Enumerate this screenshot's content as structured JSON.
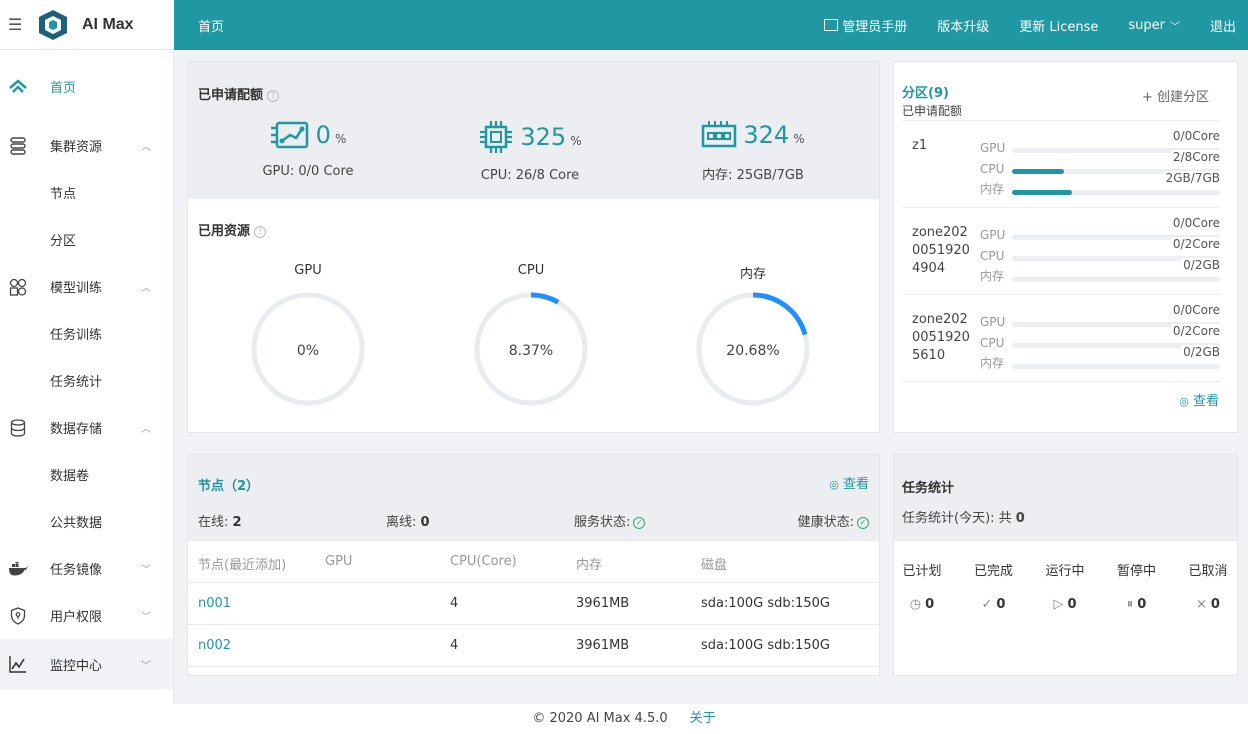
{
  "brand": {
    "name": "AI Max"
  },
  "topbar": {
    "home": "首页",
    "manual": "管理员手册",
    "upgrade": "版本升级",
    "license": "更新 License",
    "user": "super",
    "logout": "退出"
  },
  "sidebar": {
    "items": [
      {
        "label": "首页",
        "icon": "home-icon"
      },
      {
        "label": "集群资源",
        "icon": "server-icon"
      },
      {
        "label": "节点"
      },
      {
        "label": "分区"
      },
      {
        "label": "模型训练",
        "icon": "grid-icon"
      },
      {
        "label": "任务训练"
      },
      {
        "label": "任务统计"
      },
      {
        "label": "数据存储",
        "icon": "database-icon"
      },
      {
        "label": "数据卷"
      },
      {
        "label": "公共数据"
      },
      {
        "label": "任务镜像",
        "icon": "docker-icon"
      },
      {
        "label": "用户权限",
        "icon": "shield-icon"
      },
      {
        "label": "监控中心",
        "icon": "chart-line-icon"
      }
    ]
  },
  "quota": {
    "title": "已申请配额",
    "items": [
      {
        "value": "0",
        "unit": "%",
        "sub": "GPU: 0/0 Core",
        "icon": "gpu-icon"
      },
      {
        "value": "325",
        "unit": "%",
        "sub": "CPU: 26/8 Core",
        "icon": "cpu-icon"
      },
      {
        "value": "324",
        "unit": "%",
        "sub": "内存: 25GB/7GB",
        "icon": "memory-icon"
      }
    ]
  },
  "used": {
    "title": "已用资源",
    "items": [
      {
        "label": "GPU",
        "value": "0%",
        "fraction": 0
      },
      {
        "label": "CPU",
        "value": "8.37%",
        "fraction": 0.0837
      },
      {
        "label": "内存",
        "value": "20.68%",
        "fraction": 0.2068
      }
    ]
  },
  "partitions": {
    "title": "分区(9)",
    "subtitle": "已申请配额",
    "create": "+ 创建分区",
    "view": "查看",
    "groups": [
      {
        "name": "z1",
        "rows": [
          {
            "k": "GPU",
            "v": "0/0Core",
            "f": 0
          },
          {
            "k": "CPU",
            "v": "2/8Core",
            "f": 0.25
          },
          {
            "k": "内存",
            "v": "2GB/7GB",
            "f": 0.29
          }
        ]
      },
      {
        "name": "zone2020051920 4904",
        "rows": [
          {
            "k": "GPU",
            "v": "0/0Core",
            "f": 0
          },
          {
            "k": "CPU",
            "v": "0/2Core",
            "f": 0
          },
          {
            "k": "内存",
            "v": "0/2GB",
            "f": 0
          }
        ]
      },
      {
        "name": "zone2020051920 5610",
        "rows": [
          {
            "k": "GPU",
            "v": "0/0Core",
            "f": 0
          },
          {
            "k": "CPU",
            "v": "0/2Core",
            "f": 0
          },
          {
            "k": "内存",
            "v": "0/2GB",
            "f": 0
          }
        ]
      }
    ]
  },
  "nodes": {
    "title": "节点（2）",
    "view": "查看",
    "online_label": "在线:",
    "online": "2",
    "offline_label": "离线:",
    "offline": "0",
    "service": "服务状态:",
    "health": "健康状态:",
    "columns": [
      "节点(最近添加)",
      "GPU",
      "CPU(Core)",
      "内存",
      "磁盘"
    ],
    "rows": [
      {
        "name": "n001",
        "gpu": "",
        "cpu": "4",
        "mem": "3961MB",
        "disk": "sda:100G sdb:150G"
      },
      {
        "name": "n002",
        "gpu": "",
        "cpu": "4",
        "mem": "3961MB",
        "disk": "sda:100G sdb:150G"
      }
    ]
  },
  "tasks": {
    "title": "任务统计",
    "sub_label": "任务统计(今天): 共",
    "sub_total": "0",
    "cols": [
      {
        "label": "已计划",
        "icon": "clock-icon",
        "glyph": "◷",
        "value": "0"
      },
      {
        "label": "已完成",
        "icon": "check-icon",
        "glyph": "✓",
        "value": "0"
      },
      {
        "label": "运行中",
        "icon": "play-icon",
        "glyph": "▷",
        "value": "0"
      },
      {
        "label": "暂停中",
        "icon": "pause-icon",
        "glyph": "⏸",
        "value": "0"
      },
      {
        "label": "已取消",
        "icon": "x-icon",
        "glyph": "×",
        "value": "0"
      }
    ]
  },
  "footer": {
    "copyright": "© 2020 AI Max 4.5.0",
    "about": "关于"
  },
  "colors": {
    "accent": "#1f98a3",
    "ring": "#1e90ff"
  }
}
